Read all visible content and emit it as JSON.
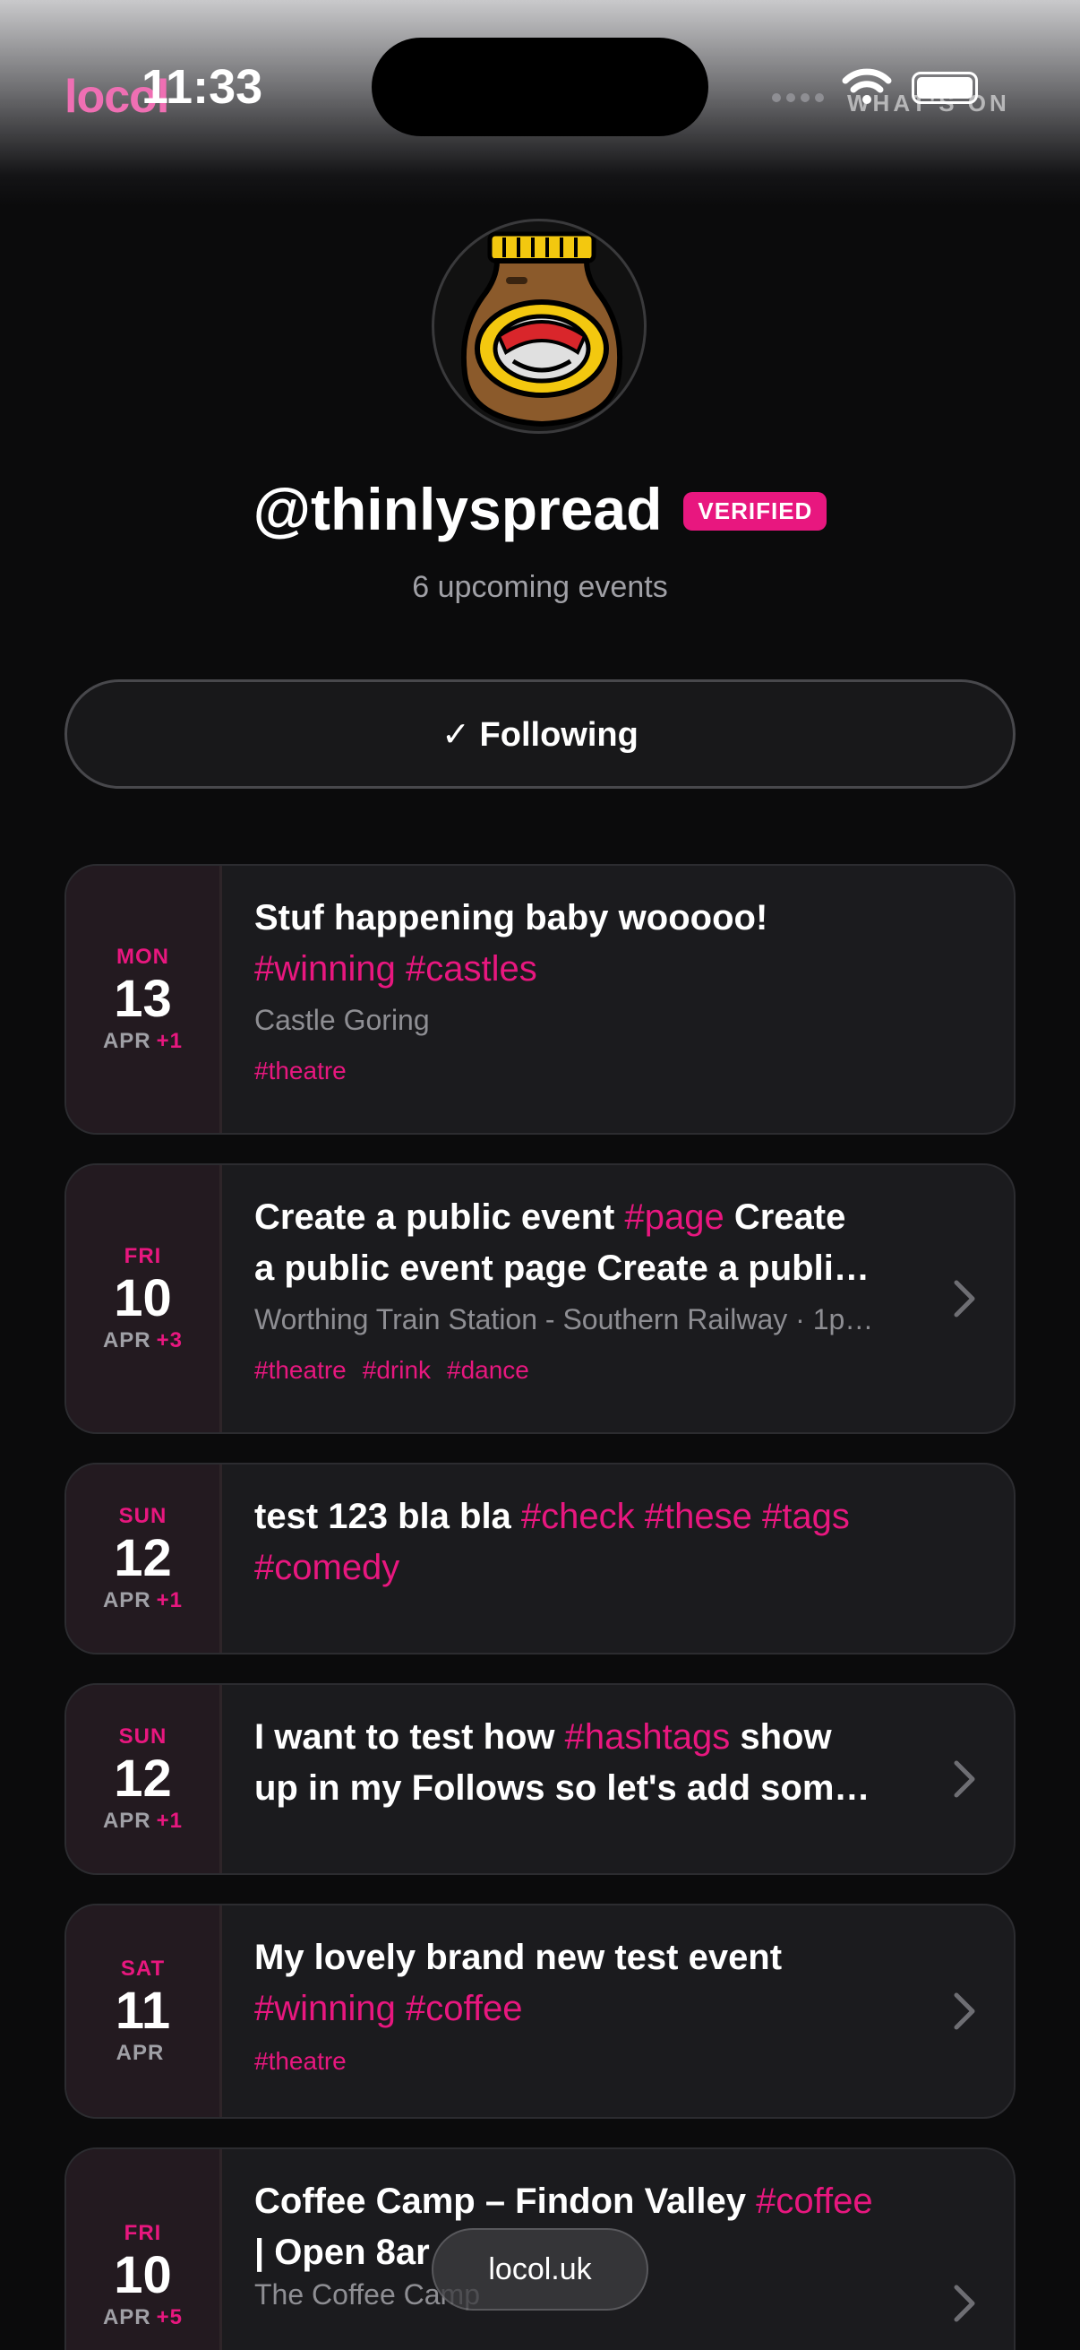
{
  "status_bar": {
    "brand": "locol",
    "time": "11:33",
    "whats_on": "WHAT'S ON"
  },
  "profile": {
    "handle": "@thinlyspread",
    "verified_badge": "VERIFIED",
    "upcoming": "6 upcoming events",
    "follow_button": "✓ Following"
  },
  "events": [
    {
      "dow": "MON",
      "day": "13",
      "month": "APR",
      "plus": "+1",
      "title_parts": [
        "Stuf happening baby wooooo! ",
        "#winning",
        " ",
        "#castles"
      ],
      "venue": "Castle Goring",
      "tags": [
        "#theatre"
      ]
    },
    {
      "dow": "FRI",
      "day": "10",
      "month": "APR",
      "plus": "+3",
      "title_line1_parts": [
        "Create a public event ",
        "#page",
        " Create"
      ],
      "title_line2": "a public event page Create a publi…",
      "venue": "Worthing Train Station - Southern Railway · 1p…",
      "tags": [
        "#theatre",
        "#drink",
        "#dance"
      ]
    },
    {
      "dow": "SUN",
      "day": "12",
      "month": "APR",
      "plus": "+1",
      "title_parts": [
        "test 123 bla bla ",
        "#check",
        " ",
        "#these",
        " ",
        "#tags"
      ],
      "title_line2_tag": "#comedy"
    },
    {
      "dow": "SUN",
      "day": "12",
      "month": "APR",
      "plus": "+1",
      "title_line1_parts": [
        "I want to test how ",
        "#hashtags",
        " show"
      ],
      "title_line2": "up in my Follows so let's add som…"
    },
    {
      "dow": "SAT",
      "day": "11",
      "month": "APR",
      "plus": "",
      "title_line1": "My lovely brand new test event",
      "title_line2_parts": [
        "#winning",
        " ",
        "#coffee"
      ],
      "tags": [
        "#theatre"
      ]
    },
    {
      "dow": "FRI",
      "day": "10",
      "month": "APR",
      "plus": "+5",
      "title_line1_parts": [
        "Coffee Camp – Findon Valley ",
        "#coffee"
      ],
      "title_line2": "| Open 8ar",
      "venue": "The Coffee Camp"
    }
  ],
  "toast": {
    "label": "locol.uk"
  },
  "colors": {
    "accent": "#e8177f",
    "brand": "#ef6fb3",
    "background": "#0b0b0c"
  }
}
